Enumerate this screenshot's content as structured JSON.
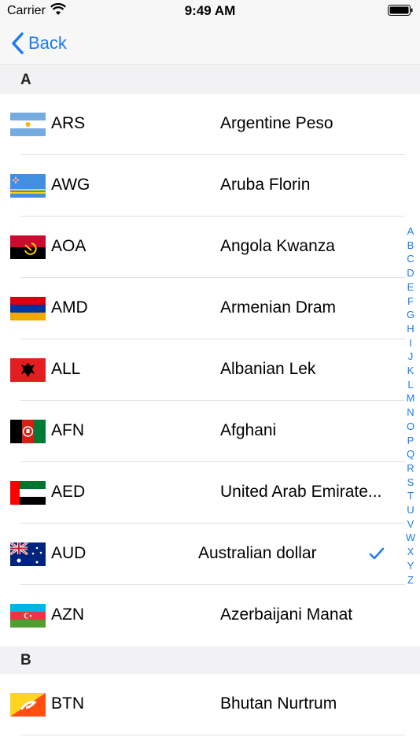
{
  "status_bar": {
    "carrier": "Carrier",
    "time": "9:49 AM"
  },
  "nav": {
    "back_label": "Back"
  },
  "colors": {
    "accent": "#1a7bf2",
    "section_bg": "#f2f2f4",
    "separator": "#e0e0e0"
  },
  "sections": [
    {
      "header": "A",
      "rows": [
        {
          "code": "ARS",
          "name": "Argentine Peso",
          "flag": "argentina-flag-icon"
        },
        {
          "code": "AWG",
          "name": "Aruba Florin",
          "flag": "aruba-flag-icon"
        },
        {
          "code": "AOA",
          "name": "Angola Kwanza",
          "flag": "angola-flag-icon"
        },
        {
          "code": "AMD",
          "name": "Armenian Dram",
          "flag": "armenia-flag-icon"
        },
        {
          "code": "ALL",
          "name": "Albanian Lek",
          "flag": "albania-flag-icon"
        },
        {
          "code": "AFN",
          "name": "Afghani",
          "flag": "afghanistan-flag-icon"
        },
        {
          "code": "AED",
          "name": "United Arab Emirate...",
          "flag": "uae-flag-icon"
        },
        {
          "code": "AUD",
          "name": "Australian dollar",
          "flag": "australia-flag-icon",
          "selected": true
        },
        {
          "code": "AZN",
          "name": "Azerbaijani Manat",
          "flag": "azerbaijan-flag-icon"
        }
      ]
    },
    {
      "header": "B",
      "rows": [
        {
          "code": "BTN",
          "name": "Bhutan Nurtrum",
          "flag": "bhutan-flag-icon"
        }
      ]
    }
  ],
  "index_letters": [
    "A",
    "B",
    "C",
    "D",
    "E",
    "F",
    "G",
    "H",
    "I",
    "J",
    "K",
    "L",
    "M",
    "N",
    "O",
    "P",
    "Q",
    "R",
    "S",
    "T",
    "U",
    "V",
    "W",
    "X",
    "Y",
    "Z"
  ]
}
